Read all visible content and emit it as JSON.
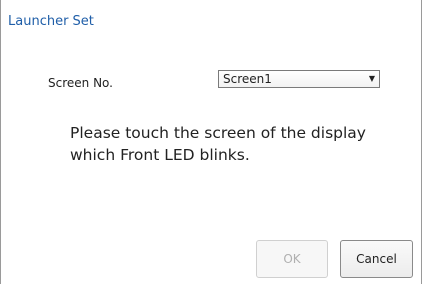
{
  "dialog": {
    "title": "Launcher Set",
    "screen_no_label": "Screen No.",
    "screen_select": {
      "selected": "Screen1",
      "arrow_icon": "dropdown-arrow-icon"
    },
    "message_lines": [
      "Please touch the screen of the display",
      "which Front LED blinks."
    ],
    "buttons": {
      "ok_label": "OK",
      "ok_enabled": false,
      "cancel_label": "Cancel"
    }
  },
  "colors": {
    "title": "#1f5ea8",
    "text": "#222222",
    "disabled_text": "#b0b0b0",
    "border": "#8a8a8a"
  }
}
